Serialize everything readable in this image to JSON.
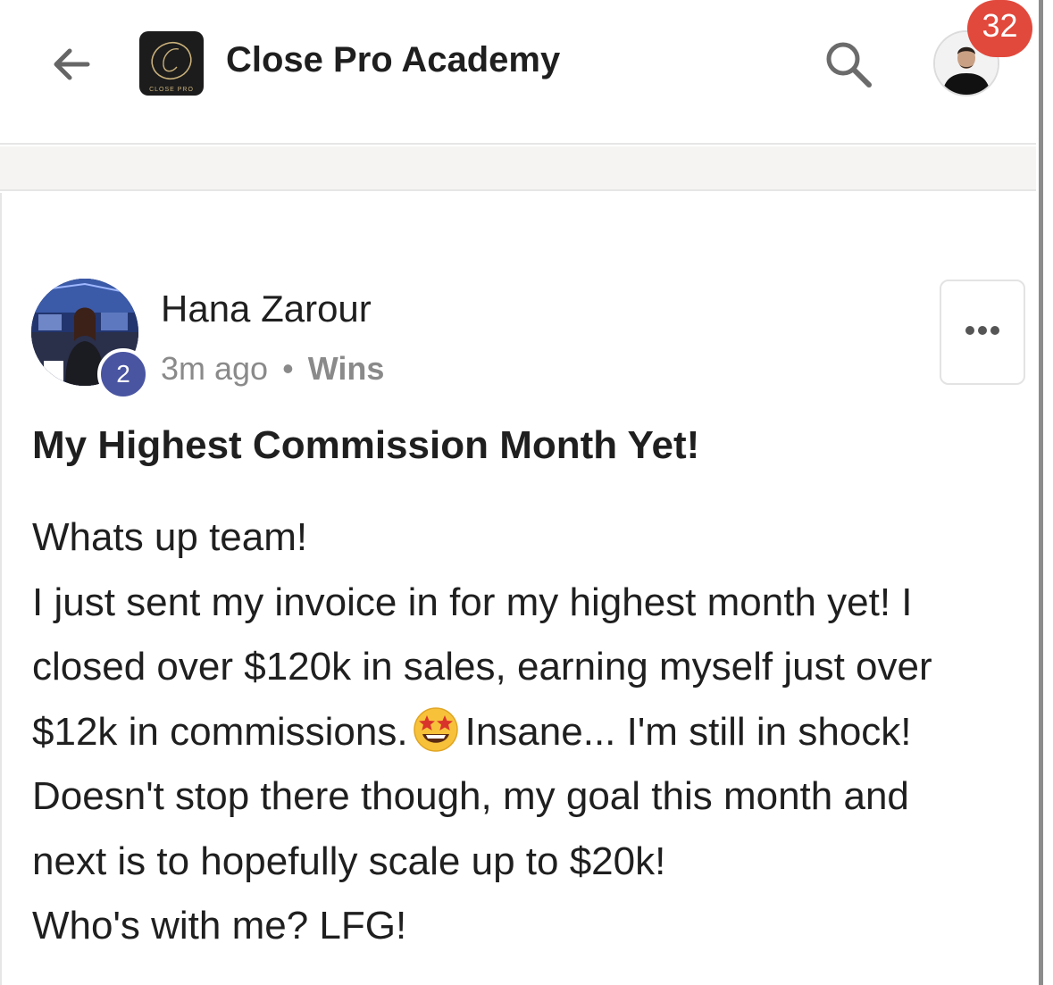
{
  "header": {
    "back_icon": "arrow-left-icon",
    "app_logo_text": "CLOSE PRO",
    "app_title": "Close Pro Academy",
    "search_icon": "search-icon",
    "notification_count": "32",
    "notification_color": "#e1493c"
  },
  "post": {
    "author": {
      "name": "Hana Zarour",
      "level": "2",
      "level_color": "#4a55a2"
    },
    "meta": {
      "time": "3m ago",
      "separator": "•",
      "category": "Wins"
    },
    "more_icon": "more-horizontal-icon",
    "title": "My Highest Commission Month Yet!",
    "body_lines": [
      "Whats up team!",
      "I just sent my invoice in for my highest month yet! I",
      "closed over $120k in sales, earning myself just over",
      "$12k in commissions.",
      "Insane... I'm still in shock!",
      "Doesn't stop there though, my goal this month and",
      "next is to hopefully scale up to $20k!",
      "Who's with me? LFG!"
    ],
    "emoji": "star-struck-emoji"
  }
}
